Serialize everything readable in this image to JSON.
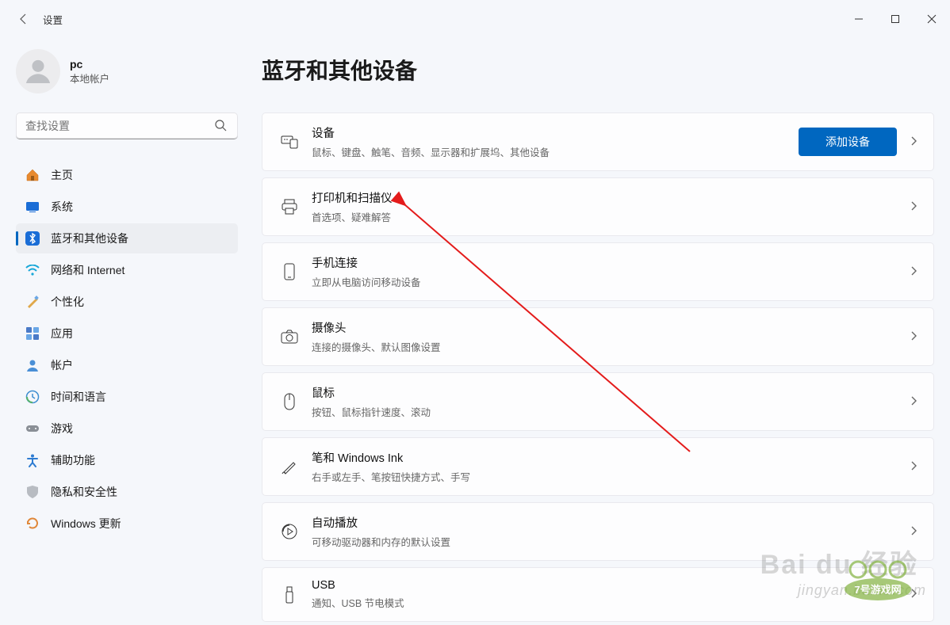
{
  "window": {
    "title": "设置"
  },
  "user": {
    "name": "pc",
    "sub": "本地帐户"
  },
  "search": {
    "placeholder": "查找设置"
  },
  "nav": {
    "home": "主页",
    "system": "系统",
    "bluetooth": "蓝牙和其他设备",
    "network": "网络和 Internet",
    "personalize": "个性化",
    "apps": "应用",
    "account": "帐户",
    "timelang": "时间和语言",
    "gaming": "游戏",
    "accessibility": "辅助功能",
    "privacy": "隐私和安全性",
    "update": "Windows 更新"
  },
  "page": {
    "title": "蓝牙和其他设备"
  },
  "buttons": {
    "addDevice": "添加设备"
  },
  "cards": {
    "devices": {
      "title": "设备",
      "sub": "鼠标、键盘、触笔、音频、显示器和扩展坞、其他设备"
    },
    "printers": {
      "title": "打印机和扫描仪",
      "sub": "首选项、疑难解答"
    },
    "phone": {
      "title": "手机连接",
      "sub": "立即从电脑访问移动设备"
    },
    "camera": {
      "title": "摄像头",
      "sub": "连接的摄像头、默认图像设置"
    },
    "mouse": {
      "title": "鼠标",
      "sub": "按钮、鼠标指针速度、滚动"
    },
    "pen": {
      "title": "笔和 Windows Ink",
      "sub": "右手或左手、笔按钮快捷方式、手写"
    },
    "autoplay": {
      "title": "自动播放",
      "sub": "可移动驱动器和内存的默认设置"
    },
    "usb": {
      "title": "USB",
      "sub": "通知、USB 节电模式"
    }
  },
  "watermarks": {
    "baidu": "Bai du 经验",
    "url": "jingyan.baidu.com",
    "logo": "7号游戏网"
  }
}
